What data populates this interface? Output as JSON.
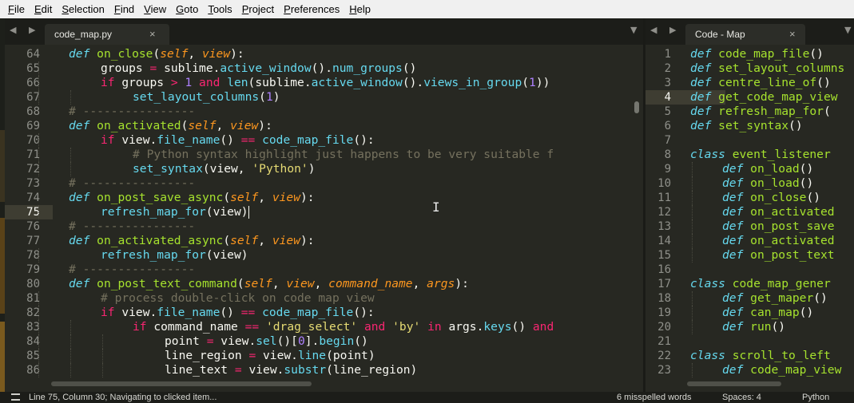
{
  "menu": [
    "File",
    "Edit",
    "Selection",
    "Find",
    "View",
    "Goto",
    "Tools",
    "Project",
    "Preferences",
    "Help"
  ],
  "tabs": {
    "left": {
      "label": "code_map.py",
      "close": "×"
    },
    "right": {
      "label": "Code - Map",
      "close": "×"
    }
  },
  "nav": {
    "arrows": "◀ ▶",
    "dropdown": "▼"
  },
  "editor": {
    "current_line": "75",
    "lines": [
      {
        "n": "64",
        "i": 1,
        "t": [
          [
            "k",
            "def "
          ],
          [
            "f",
            "on_close"
          ],
          [
            "",
            "("
          ],
          [
            "p",
            "self"
          ],
          [
            "",
            ", "
          ],
          [
            "p",
            "view"
          ],
          [
            "",
            "):"
          ]
        ]
      },
      {
        "n": "65",
        "i": 2,
        "t": [
          [
            "",
            "groups "
          ],
          [
            "o",
            "="
          ],
          [
            "",
            " sublime."
          ],
          [
            "b",
            "active_window"
          ],
          [
            "",
            "()."
          ],
          [
            "b",
            "num_groups"
          ],
          [
            "",
            "()"
          ]
        ]
      },
      {
        "n": "66",
        "i": 2,
        "t": [
          [
            "o",
            "if"
          ],
          [
            "",
            " groups "
          ],
          [
            "o",
            ">"
          ],
          [
            " ",
            ""
          ],
          [
            "n",
            " 1"
          ],
          [
            "o",
            " and "
          ],
          [
            "b",
            "len"
          ],
          [
            "",
            "(sublime."
          ],
          [
            "b",
            "active_window"
          ],
          [
            "",
            "()."
          ],
          [
            "b",
            "views_in_group"
          ],
          [
            "",
            "("
          ],
          [
            "n",
            "1"
          ],
          [
            "",
            "))"
          ]
        ]
      },
      {
        "n": "67",
        "i": 3,
        "t": [
          [
            "b",
            "set_layout_columns"
          ],
          [
            "",
            "("
          ],
          [
            "n",
            "1"
          ],
          [
            "",
            ")"
          ]
        ]
      },
      {
        "n": "68",
        "i": 1,
        "t": [
          [
            "c",
            "# ----------------"
          ]
        ]
      },
      {
        "n": "69",
        "i": 1,
        "t": [
          [
            "k",
            "def "
          ],
          [
            "f",
            "on_activated"
          ],
          [
            "",
            "("
          ],
          [
            "p",
            "self"
          ],
          [
            "",
            ", "
          ],
          [
            "p",
            "view"
          ],
          [
            "",
            "):"
          ]
        ]
      },
      {
        "n": "70",
        "i": 2,
        "t": [
          [
            "o",
            "if"
          ],
          [
            "",
            " view."
          ],
          [
            "b",
            "file_name"
          ],
          [
            "",
            "() "
          ],
          [
            "o",
            "=="
          ],
          [
            " ",
            ""
          ],
          [
            "b",
            " code_map_file"
          ],
          [
            "",
            "():"
          ]
        ]
      },
      {
        "n": "71",
        "i": 3,
        "t": [
          [
            "c",
            "# Python syntax highlight just happens to be very suitable f"
          ]
        ]
      },
      {
        "n": "72",
        "i": 3,
        "t": [
          [
            "b",
            "set_syntax"
          ],
          [
            "",
            "(view, "
          ],
          [
            "s",
            "'Python'"
          ],
          [
            "",
            ")"
          ]
        ]
      },
      {
        "n": "73",
        "i": 1,
        "t": [
          [
            "c",
            "# ----------------"
          ]
        ]
      },
      {
        "n": "74",
        "i": 1,
        "t": [
          [
            "k",
            "def "
          ],
          [
            "f",
            "on_post_save_async"
          ],
          [
            "",
            "("
          ],
          [
            "p",
            "self"
          ],
          [
            "",
            ", "
          ],
          [
            "p",
            "view"
          ],
          [
            "",
            "):"
          ]
        ]
      },
      {
        "n": "75",
        "i": 2,
        "t": [
          [
            "b",
            "refresh_map_for"
          ],
          [
            "",
            "(view)"
          ]
        ],
        "caret": true
      },
      {
        "n": "76",
        "i": 1,
        "t": [
          [
            "c",
            "# ----------------"
          ]
        ]
      },
      {
        "n": "77",
        "i": 1,
        "t": [
          [
            "k",
            "def "
          ],
          [
            "f",
            "on_activated_async"
          ],
          [
            "",
            "("
          ],
          [
            "p",
            "self"
          ],
          [
            "",
            ", "
          ],
          [
            "p",
            "view"
          ],
          [
            "",
            "):"
          ]
        ]
      },
      {
        "n": "78",
        "i": 2,
        "t": [
          [
            "b",
            "refresh_map_for"
          ],
          [
            "",
            "(view)"
          ]
        ]
      },
      {
        "n": "79",
        "i": 1,
        "t": [
          [
            "c",
            "# ----------------"
          ]
        ]
      },
      {
        "n": "80",
        "i": 1,
        "t": [
          [
            "k",
            "def "
          ],
          [
            "f",
            "on_post_text_command"
          ],
          [
            "",
            "("
          ],
          [
            "p",
            "self"
          ],
          [
            "",
            ", "
          ],
          [
            "p",
            "view"
          ],
          [
            "",
            ", "
          ],
          [
            "p",
            "command_name"
          ],
          [
            "",
            ", "
          ],
          [
            "p",
            "args"
          ],
          [
            "",
            "):"
          ]
        ]
      },
      {
        "n": "81",
        "i": 2,
        "t": [
          [
            "c",
            "# process double-click on code map view"
          ]
        ]
      },
      {
        "n": "82",
        "i": 2,
        "t": [
          [
            "o",
            "if"
          ],
          [
            "",
            " view."
          ],
          [
            "b",
            "file_name"
          ],
          [
            "",
            "() "
          ],
          [
            "o",
            "=="
          ],
          [
            " ",
            ""
          ],
          [
            "b",
            " code_map_file"
          ],
          [
            "",
            "():"
          ]
        ]
      },
      {
        "n": "83",
        "i": 3,
        "t": [
          [
            "o",
            "if"
          ],
          [
            "",
            " command_name "
          ],
          [
            "o",
            "=="
          ],
          [
            " ",
            ""
          ],
          [
            "s",
            " 'drag_select'"
          ],
          [
            "o",
            " and "
          ],
          [
            "s",
            "'by'"
          ],
          [
            "o",
            " in "
          ],
          [
            "",
            "args."
          ],
          [
            "b",
            "keys"
          ],
          [
            "",
            "() "
          ],
          [
            "o",
            "and"
          ]
        ]
      },
      {
        "n": "84",
        "i": 4,
        "t": [
          [
            "",
            "point "
          ],
          [
            "o",
            "="
          ],
          [
            "",
            " view."
          ],
          [
            "b",
            "sel"
          ],
          [
            "",
            "()["
          ],
          [
            "n",
            "0"
          ],
          [
            "",
            "]."
          ],
          [
            "b",
            "begin"
          ],
          [
            "",
            "()"
          ]
        ]
      },
      {
        "n": "85",
        "i": 4,
        "t": [
          [
            "",
            "line_region "
          ],
          [
            "o",
            "="
          ],
          [
            "",
            " view."
          ],
          [
            "b",
            "line"
          ],
          [
            "",
            "(point)"
          ]
        ]
      },
      {
        "n": "86",
        "i": 4,
        "t": [
          [
            "",
            "line_text "
          ],
          [
            "o",
            "="
          ],
          [
            "",
            " view."
          ],
          [
            "b",
            "substr"
          ],
          [
            "",
            "(line_region)"
          ]
        ]
      }
    ]
  },
  "map": {
    "current_line": "4",
    "lines": [
      {
        "n": "1",
        "i": 0,
        "t": [
          [
            "k",
            "def "
          ],
          [
            "f",
            "code_map_file"
          ],
          [
            "",
            "()"
          ]
        ]
      },
      {
        "n": "2",
        "i": 0,
        "t": [
          [
            "k",
            "def "
          ],
          [
            "f",
            "set_layout_columns"
          ]
        ]
      },
      {
        "n": "3",
        "i": 0,
        "t": [
          [
            "k",
            "def "
          ],
          [
            "f",
            "centre_line_of"
          ],
          [
            "",
            "()"
          ]
        ]
      },
      {
        "n": "4",
        "i": 0,
        "t": [
          [
            "k",
            "def "
          ],
          [
            "f",
            "get_code_map_view"
          ]
        ]
      },
      {
        "n": "5",
        "i": 0,
        "t": [
          [
            "k",
            "def "
          ],
          [
            "f",
            "refresh_map_for"
          ],
          [
            "",
            "("
          ]
        ]
      },
      {
        "n": "6",
        "i": 0,
        "t": [
          [
            "k",
            "def "
          ],
          [
            "f",
            "set_syntax"
          ],
          [
            "",
            "()"
          ]
        ]
      },
      {
        "n": "7",
        "i": 0,
        "t": []
      },
      {
        "n": "8",
        "i": 0,
        "t": [
          [
            "k",
            "class "
          ],
          [
            "f",
            "event_listener"
          ]
        ]
      },
      {
        "n": "9",
        "i": 1,
        "t": [
          [
            "k",
            "def "
          ],
          [
            "f",
            "on_load"
          ],
          [
            "",
            "()"
          ]
        ]
      },
      {
        "n": "10",
        "i": 1,
        "t": [
          [
            "k",
            "def "
          ],
          [
            "f",
            "on_load"
          ],
          [
            "",
            "()"
          ]
        ]
      },
      {
        "n": "11",
        "i": 1,
        "t": [
          [
            "k",
            "def "
          ],
          [
            "f",
            "on_close"
          ],
          [
            "",
            "()"
          ]
        ]
      },
      {
        "n": "12",
        "i": 1,
        "t": [
          [
            "k",
            "def "
          ],
          [
            "f",
            "on_activated"
          ]
        ]
      },
      {
        "n": "13",
        "i": 1,
        "t": [
          [
            "k",
            "def "
          ],
          [
            "f",
            "on_post_save"
          ]
        ]
      },
      {
        "n": "14",
        "i": 1,
        "t": [
          [
            "k",
            "def "
          ],
          [
            "f",
            "on_activated"
          ]
        ]
      },
      {
        "n": "15",
        "i": 1,
        "t": [
          [
            "k",
            "def "
          ],
          [
            "f",
            "on_post_text"
          ]
        ]
      },
      {
        "n": "16",
        "i": 0,
        "t": []
      },
      {
        "n": "17",
        "i": 0,
        "t": [
          [
            "k",
            "class "
          ],
          [
            "f",
            "code_map_gener"
          ]
        ]
      },
      {
        "n": "18",
        "i": 1,
        "t": [
          [
            "k",
            "def "
          ],
          [
            "f",
            "get_maper"
          ],
          [
            "",
            "()"
          ]
        ]
      },
      {
        "n": "19",
        "i": 1,
        "t": [
          [
            "k",
            "def "
          ],
          [
            "f",
            "can_map"
          ],
          [
            "",
            "()"
          ]
        ]
      },
      {
        "n": "20",
        "i": 1,
        "t": [
          [
            "k",
            "def "
          ],
          [
            "f",
            "run"
          ],
          [
            "",
            "()"
          ]
        ]
      },
      {
        "n": "21",
        "i": 0,
        "t": []
      },
      {
        "n": "22",
        "i": 0,
        "t": [
          [
            "k",
            "class "
          ],
          [
            "f",
            "scroll_to_left"
          ]
        ]
      },
      {
        "n": "23",
        "i": 1,
        "t": [
          [
            "k",
            "def "
          ],
          [
            "f",
            "code_map_view"
          ]
        ]
      }
    ]
  },
  "status": {
    "position": "Line 75, Column 30; Navigating to clicked item...",
    "spelling": "6 misspelled words",
    "spaces": "Spaces: 4",
    "syntax": "Python"
  },
  "colors": {
    "background": "#272822",
    "keyword": "#66d9ef",
    "function": "#a6e22e",
    "param": "#fd971f",
    "operator": "#f92672",
    "number": "#ae81ff",
    "string": "#e6db74",
    "comment": "#75715e"
  }
}
